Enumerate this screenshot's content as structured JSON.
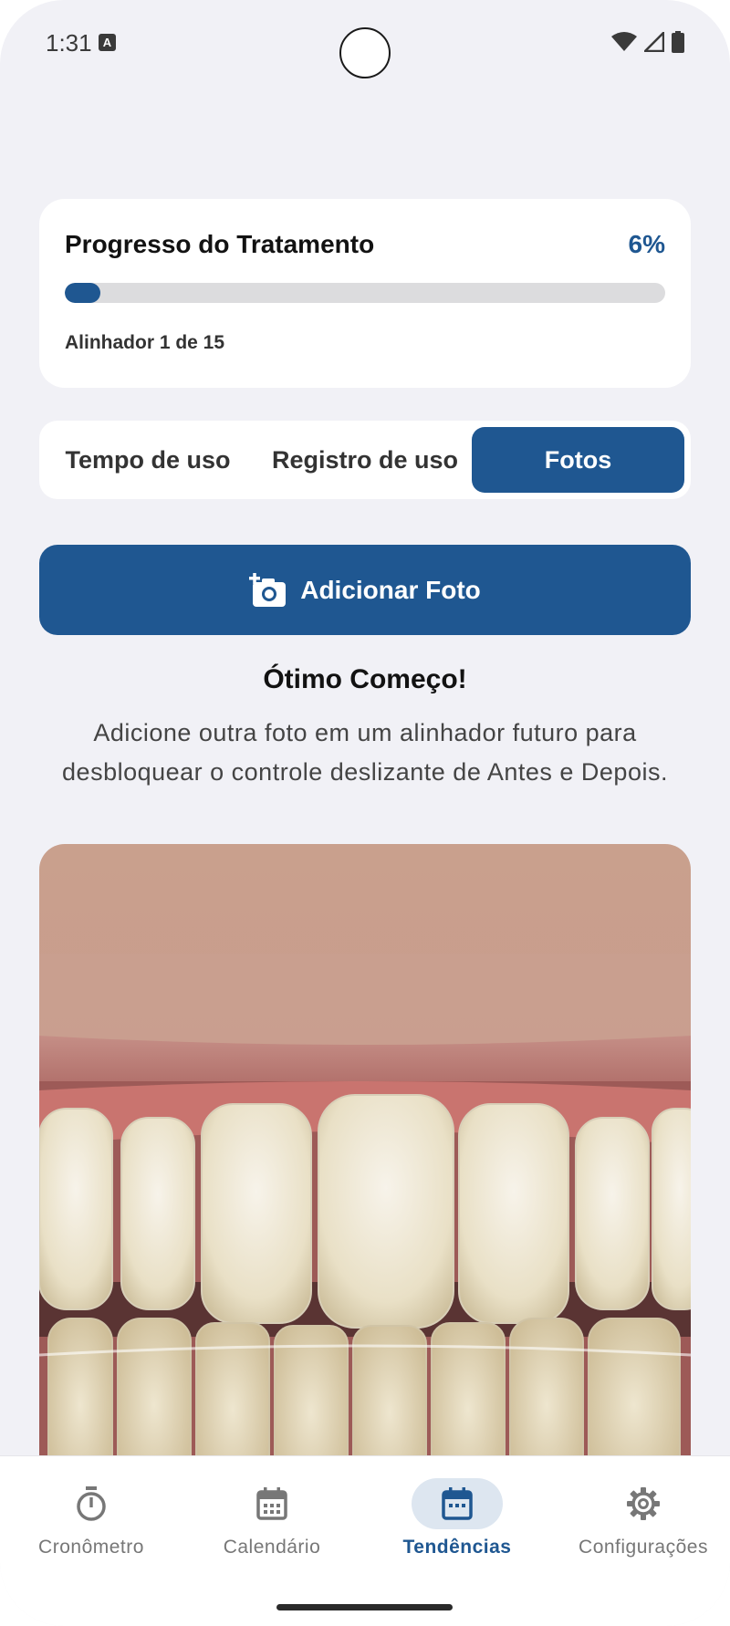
{
  "status_bar": {
    "time": "1:31",
    "a_badge": "A"
  },
  "progress_card": {
    "title": "Progresso do Tratamento",
    "percent_label": "6%",
    "progress_value": 0.06,
    "aligner_text": "Alinhador 1 de 15"
  },
  "tabs": [
    {
      "label": "Tempo de uso",
      "active": false
    },
    {
      "label": "Registro de uso",
      "active": false
    },
    {
      "label": "Fotos",
      "active": true
    }
  ],
  "add_photo": {
    "label": "Adicionar Foto",
    "icon": "add-camera-icon"
  },
  "message": {
    "headline": "Ótimo Começo!",
    "body": "Adicione outra foto em um alinhador futuro para desbloquear o controle deslizante de Antes e Depois."
  },
  "bottom_nav": [
    {
      "label": "Cronômetro",
      "icon": "stopwatch-icon",
      "active": false
    },
    {
      "label": "Calendário",
      "icon": "calendar-icon",
      "active": false
    },
    {
      "label": "Tendências",
      "icon": "calendar-icon",
      "active": true
    },
    {
      "label": "Configurações",
      "icon": "gear-icon",
      "active": false
    }
  ],
  "colors": {
    "accent": "#1f5791",
    "background": "#f1f1f6",
    "track": "#dcdcde"
  }
}
